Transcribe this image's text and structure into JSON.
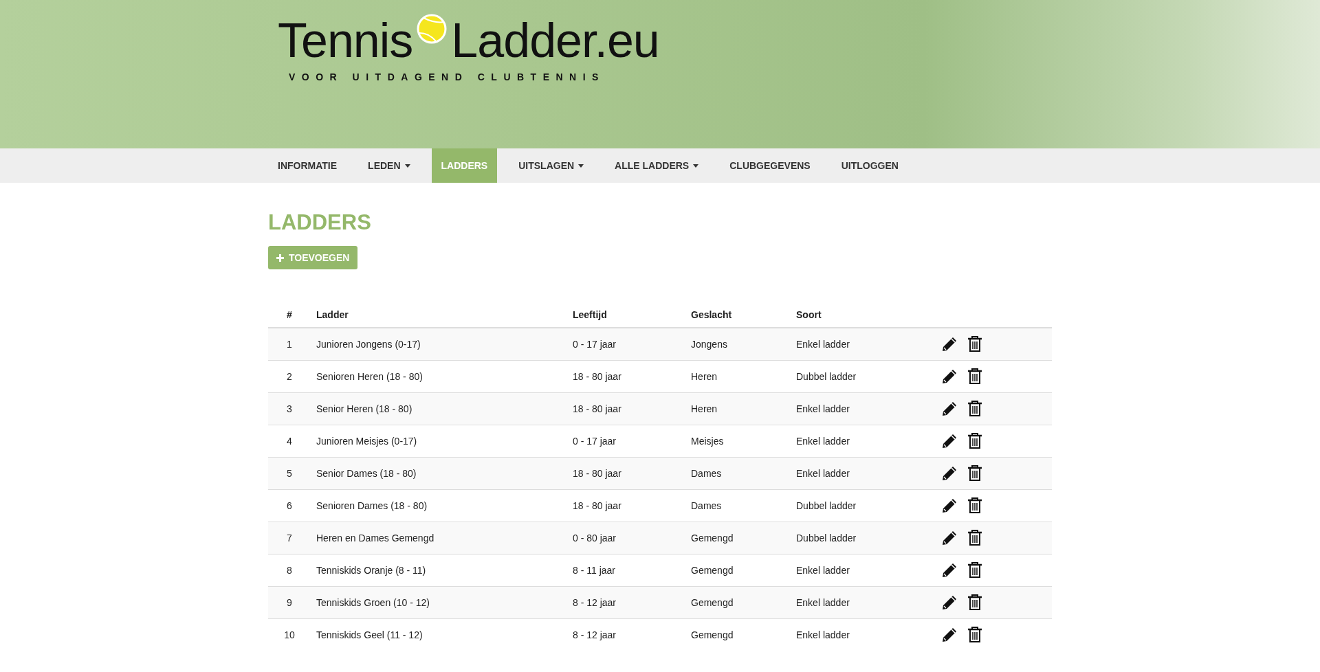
{
  "logo": {
    "word_1": "Tennis",
    "word_2": "Ladder.eu",
    "tagline": "VOOR UITDAGEND CLUBTENNIS"
  },
  "nav": [
    {
      "label": "INFORMATIE",
      "dropdown": false,
      "selected": false
    },
    {
      "label": "LEDEN",
      "dropdown": true,
      "selected": false
    },
    {
      "label": "LADDERS",
      "dropdown": false,
      "selected": true
    },
    {
      "label": "UITSLAGEN",
      "dropdown": true,
      "selected": false
    },
    {
      "label": "ALLE LADDERS",
      "dropdown": true,
      "selected": false
    },
    {
      "label": "CLUBGEGEVENS",
      "dropdown": false,
      "selected": false
    },
    {
      "label": "UITLOGGEN",
      "dropdown": false,
      "selected": false
    }
  ],
  "page_title": "LADDERS",
  "add_button": "TOEVOEGEN",
  "table": {
    "columns": [
      "#",
      "Ladder",
      "Leeftijd",
      "Geslacht",
      "Soort"
    ],
    "rows": [
      [
        "1",
        "Junioren Jongens (0-17)",
        "0 - 17 jaar",
        "Jongens",
        "Enkel ladder"
      ],
      [
        "2",
        "Senioren Heren (18 - 80)",
        "18 - 80 jaar",
        "Heren",
        "Dubbel ladder"
      ],
      [
        "3",
        "Senior Heren (18 - 80)",
        "18 - 80 jaar",
        "Heren",
        "Enkel ladder"
      ],
      [
        "4",
        "Junioren Meisjes (0-17)",
        "0 - 17 jaar",
        "Meisjes",
        "Enkel ladder"
      ],
      [
        "5",
        "Senior Dames (18 - 80)",
        "18 - 80 jaar",
        "Dames",
        "Enkel ladder"
      ],
      [
        "6",
        "Senioren Dames (18 - 80)",
        "18 - 80 jaar",
        "Dames",
        "Dubbel ladder"
      ],
      [
        "7",
        "Heren en Dames Gemengd",
        "0 - 80 jaar",
        "Gemengd",
        "Dubbel ladder"
      ],
      [
        "8",
        "Tenniskids Oranje (8 - 11)",
        "8 - 11 jaar",
        "Gemengd",
        "Enkel ladder"
      ],
      [
        "9",
        "Tenniskids Groen (10 - 12)",
        "8 - 12 jaar",
        "Gemengd",
        "Enkel ladder"
      ],
      [
        "10",
        "Tenniskids Geel (11 - 12)",
        "8 - 12 jaar",
        "Gemengd",
        "Enkel ladder"
      ]
    ]
  }
}
